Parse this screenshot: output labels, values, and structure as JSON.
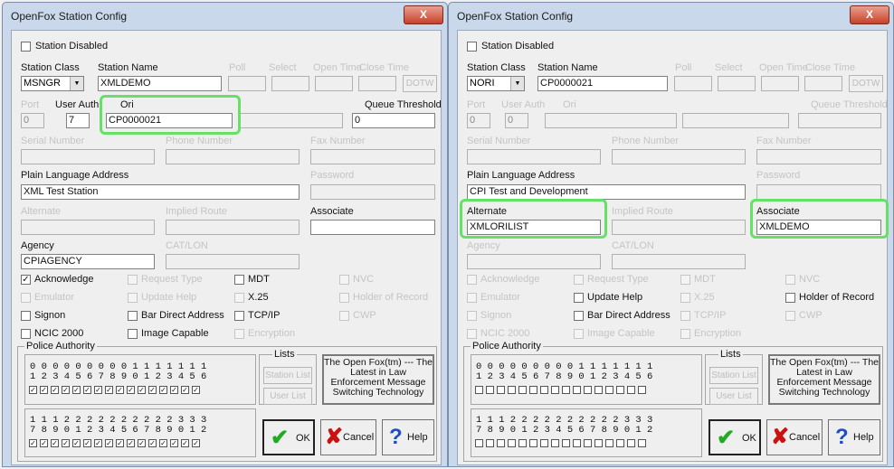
{
  "dialogs": [
    {
      "title": "OpenFox Station Config",
      "close": "X",
      "station_disabled": "Station Disabled",
      "station_class_label": "Station Class",
      "station_class": "MSNGR",
      "station_name_label": "Station Name",
      "station_name": "XMLDEMO",
      "poll": "Poll",
      "select": "Select",
      "open_time": "Open Time",
      "close_time": "Close Time",
      "dotw": "DOTW",
      "port_label": "Port",
      "port": "0",
      "user_auth_label": "User Auth",
      "user_auth": "7",
      "ori_label": "Ori",
      "ori": "CP0000021",
      "queue_threshold_label": "Queue Threshold",
      "queue_threshold": "0",
      "serial_number": "Serial Number",
      "phone_number": "Phone Number",
      "fax_number": "Fax Number",
      "pla_label": "Plain Language Address",
      "pla": "XML Test Station",
      "password_label": "Password",
      "alternate_label": "Alternate",
      "alternate": "",
      "implied_route": "Implied Route",
      "associate_label": "Associate",
      "associate": "",
      "agency_label": "Agency",
      "agency": "CPIAGENCY",
      "catlon": "CAT/LON",
      "checkboxes": {
        "acknowledge": {
          "label": "Acknowledge",
          "mark": "✓"
        },
        "request_type": {
          "label": "Request Type",
          "mark": ""
        },
        "mdt": {
          "label": "MDT",
          "mark": ""
        },
        "nvc": {
          "label": "NVC",
          "mark": ""
        },
        "emulator": {
          "label": "Emulator",
          "mark": ""
        },
        "update_help": {
          "label": "Update Help",
          "mark": ""
        },
        "x25": {
          "label": "X.25",
          "mark": ""
        },
        "holder": {
          "label": "Holder of Record",
          "mark": ""
        },
        "signon": {
          "label": "Signon",
          "mark": ""
        },
        "bar_direct": {
          "label": "Bar Direct Address",
          "mark": ""
        },
        "tcpip": {
          "label": "TCP/IP",
          "mark": ""
        },
        "cwp": {
          "label": "CWP",
          "mark": ""
        },
        "ncic": {
          "label": "NCIC 2000",
          "mark": ""
        },
        "image_capable": {
          "label": "Image Capable",
          "mark": ""
        },
        "encryption": {
          "label": "Encryption",
          "mark": ""
        }
      },
      "police_authority": "Police Authority",
      "pa_row1_tens": "0 0 0 0 0 0 0 0 0 1 1 1 1 1 1 1",
      "pa_row1_ones": "1 2 3 4 5 6 7 8 9 0 1 2 3 4 5 6",
      "pa_row2_tens": "1 1 1 2 2 2 2 2 2 2 2 2 2 3 3 3",
      "pa_row2_ones": "7 8 9 0 1 2 3 4 5 6 7 8 9 0 1 2",
      "pa_checks": "✓",
      "lists": "Lists",
      "station_list": "Station List",
      "user_list": "User List",
      "info_text": "The Open Fox(tm) --- The Latest in Law Enforcement Message Switching Technology",
      "ok": "OK",
      "cancel": "Cancel",
      "help": "Help"
    },
    {
      "title": "OpenFox Station Config",
      "close": "X",
      "station_disabled": "Station Disabled",
      "station_class_label": "Station Class",
      "station_class": "NORI",
      "station_name_label": "Station Name",
      "station_name": "CP0000021",
      "poll": "Poll",
      "select": "Select",
      "open_time": "Open Time",
      "close_time": "Close Time",
      "dotw": "DOTW",
      "port_label": "Port",
      "port": "0",
      "user_auth_label": "User Auth",
      "user_auth": "0",
      "ori_label": "Ori",
      "ori": "",
      "queue_threshold_label": "Queue Threshold",
      "queue_threshold": "",
      "serial_number": "Serial Number",
      "phone_number": "Phone Number",
      "fax_number": "Fax Number",
      "pla_label": "Plain Language Address",
      "pla": "CPI Test and Development",
      "password_label": "Password",
      "alternate_label": "Alternate",
      "alternate": "XMLORILIST",
      "implied_route": "Implied Route",
      "associate_label": "Associate",
      "associate": "XMLDEMO",
      "agency_label": "Agency",
      "agency": "",
      "catlon": "CAT/LON",
      "checkboxes": {
        "acknowledge": {
          "label": "Acknowledge",
          "mark": ""
        },
        "request_type": {
          "label": "Request Type",
          "mark": ""
        },
        "mdt": {
          "label": "MDT",
          "mark": ""
        },
        "nvc": {
          "label": "NVC",
          "mark": ""
        },
        "emulator": {
          "label": "Emulator",
          "mark": ""
        },
        "update_help": {
          "label": "Update Help",
          "mark": ""
        },
        "x25": {
          "label": "X.25",
          "mark": ""
        },
        "holder": {
          "label": "Holder of Record",
          "mark": ""
        },
        "signon": {
          "label": "Signon",
          "mark": ""
        },
        "bar_direct": {
          "label": "Bar Direct Address",
          "mark": ""
        },
        "tcpip": {
          "label": "TCP/IP",
          "mark": ""
        },
        "cwp": {
          "label": "CWP",
          "mark": ""
        },
        "ncic": {
          "label": "NCIC 2000",
          "mark": ""
        },
        "image_capable": {
          "label": "Image Capable",
          "mark": ""
        },
        "encryption": {
          "label": "Encryption",
          "mark": ""
        }
      },
      "police_authority": "Police Authority",
      "pa_row1_tens": "0 0 0 0 0 0 0 0 0 1 1 1 1 1 1 1",
      "pa_row1_ones": "1 2 3 4 5 6 7 8 9 0 1 2 3 4 5 6",
      "pa_row2_tens": "1 1 1 2 2 2 2 2 2 2 2 2 2 3 3 3",
      "pa_row2_ones": "7 8 9 0 1 2 3 4 5 6 7 8 9 0 1 2",
      "pa_checks": "",
      "lists": "Lists",
      "station_list": "Station List",
      "user_list": "User List",
      "info_text": "The Open Fox(tm) --- The Latest in Law Enforcement Message Switching Technology",
      "ok": "OK",
      "cancel": "Cancel",
      "help": "Help"
    }
  ],
  "colors": {
    "highlight": "#66e066",
    "titlebar": "#c9d8ea",
    "close_button": "#c8402a",
    "ok_icon": "#22aa22",
    "cancel_icon": "#cc1111",
    "help_icon": "#1c4fc0"
  }
}
